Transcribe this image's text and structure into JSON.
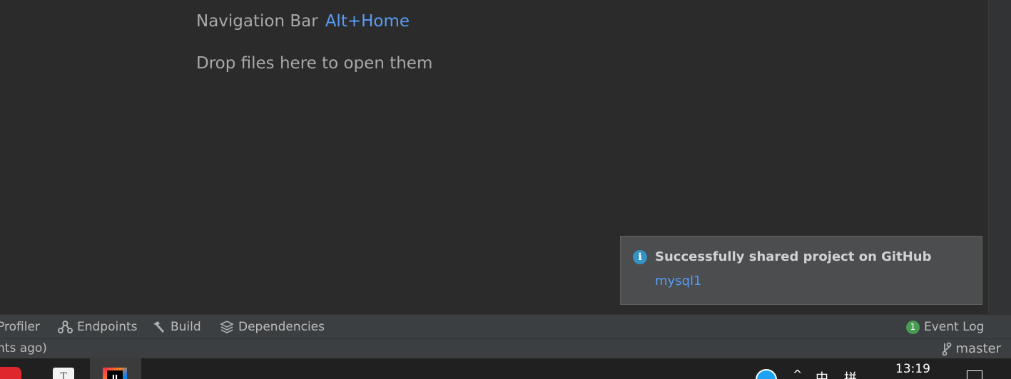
{
  "editor": {
    "hint_label": "Navigation Bar",
    "hint_shortcut": "Alt+Home",
    "drop_hint": "Drop files here to open them"
  },
  "notification": {
    "icon": "info-icon",
    "title": "Successfully shared project on GitHub",
    "link": "mysql1"
  },
  "tool_windows": {
    "left": [
      {
        "label": "Profiler",
        "icon": null
      },
      {
        "label": "Endpoints",
        "icon": "endpoints-icon"
      },
      {
        "label": "Build",
        "icon": "hammer-icon"
      },
      {
        "label": "Dependencies",
        "icon": "layers-icon"
      }
    ],
    "event_log": {
      "label": "Event Log",
      "count": "1"
    }
  },
  "status_bar": {
    "message": "nts ago)",
    "branch": "master"
  },
  "taskbar": {
    "tray_ime_1": "中",
    "tray_ime_2": "拼",
    "tray_chevron": "^",
    "clock": "13:19"
  },
  "colors": {
    "editor_bg": "#2b2b2b",
    "link": "#589df6",
    "balloon_bg": "#4b4d4f",
    "badge_green": "#499c54",
    "info_blue": "#3592c4"
  }
}
